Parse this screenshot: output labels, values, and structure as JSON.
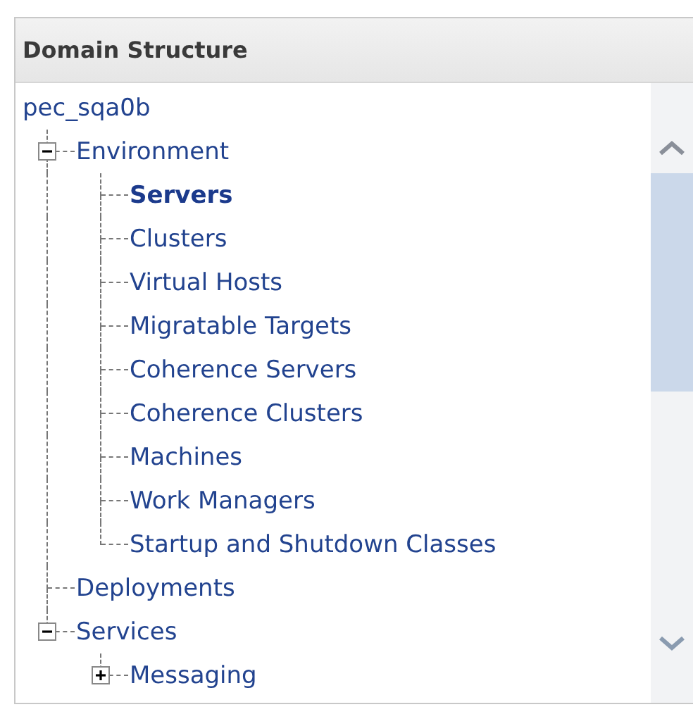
{
  "panel": {
    "title": "Domain Structure"
  },
  "tree": [
    {
      "label": "pec_sqa0b",
      "selected": false,
      "children": [
        {
          "label": "Environment",
          "selected": false,
          "expanded": true,
          "children": [
            {
              "label": "Servers",
              "selected": true
            },
            {
              "label": "Clusters",
              "selected": false
            },
            {
              "label": "Virtual Hosts",
              "selected": false
            },
            {
              "label": "Migratable Targets",
              "selected": false
            },
            {
              "label": "Coherence Servers",
              "selected": false
            },
            {
              "label": "Coherence Clusters",
              "selected": false
            },
            {
              "label": "Machines",
              "selected": false
            },
            {
              "label": "Work Managers",
              "selected": false
            },
            {
              "label": "Startup and Shutdown Classes",
              "selected": false
            }
          ]
        },
        {
          "label": "Deployments",
          "selected": false
        },
        {
          "label": "Services",
          "selected": false,
          "expanded": true,
          "children": [
            {
              "label": "Messaging",
              "selected": false,
              "expanded": false
            }
          ]
        }
      ]
    }
  ]
}
